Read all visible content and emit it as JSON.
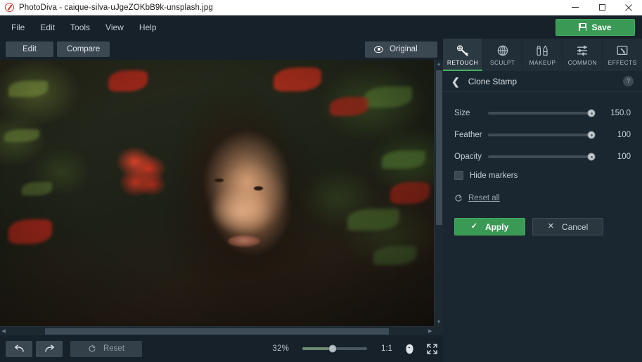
{
  "window": {
    "app_name": "PhotoDiva",
    "title": "PhotoDiva - caique-silva-uJgeZOKbB9k-unsplash.jpg",
    "minimize_label": "Minimize",
    "maximize_label": "Maximize",
    "close_label": "Close"
  },
  "menubar": {
    "items": [
      {
        "label": "File"
      },
      {
        "label": "Edit"
      },
      {
        "label": "Tools"
      },
      {
        "label": "View"
      },
      {
        "label": "Help"
      }
    ],
    "save_label": "Save"
  },
  "viewbar": {
    "edit_label": "Edit",
    "compare_label": "Compare",
    "original_label": "Original"
  },
  "bottombar": {
    "undo_label": "Undo",
    "redo_label": "Redo",
    "reset_label": "Reset",
    "zoom_percent": "32%",
    "zoom_value": 32,
    "fit_label": "1:1",
    "face_label": "Face zoom",
    "fullscreen_label": "Fit to screen"
  },
  "tabs": [
    {
      "label": "RETOUCH",
      "icon": "healing-brush-icon",
      "active": true
    },
    {
      "label": "SCULPT",
      "icon": "sculpt-globe-icon",
      "active": false
    },
    {
      "label": "MAKEUP",
      "icon": "makeup-brushes-icon",
      "active": false
    },
    {
      "label": "COMMON",
      "icon": "sliders-icon",
      "active": false
    },
    {
      "label": "EFFECTS",
      "icon": "effects-frame-icon",
      "active": false
    }
  ],
  "panel": {
    "back_label": "Back",
    "title": "Clone Stamp",
    "help_label": "?",
    "sliders": [
      {
        "name": "Size",
        "value": "150.0",
        "percent": 100
      },
      {
        "name": "Feather",
        "value": "100",
        "percent": 100
      },
      {
        "name": "Opacity",
        "value": "100",
        "percent": 100
      }
    ],
    "checkbox": {
      "label": "Hide markers",
      "checked": false
    },
    "reset_all_label": "Reset all",
    "apply_label": "Apply",
    "cancel_label": "Cancel"
  },
  "colors": {
    "accent_green": "#3a9a55",
    "tab_underline": "#46b05f",
    "panel_bg": "#1b2730",
    "toolbar_bg": "#16212a",
    "slider_fill": "#6d8a70"
  }
}
